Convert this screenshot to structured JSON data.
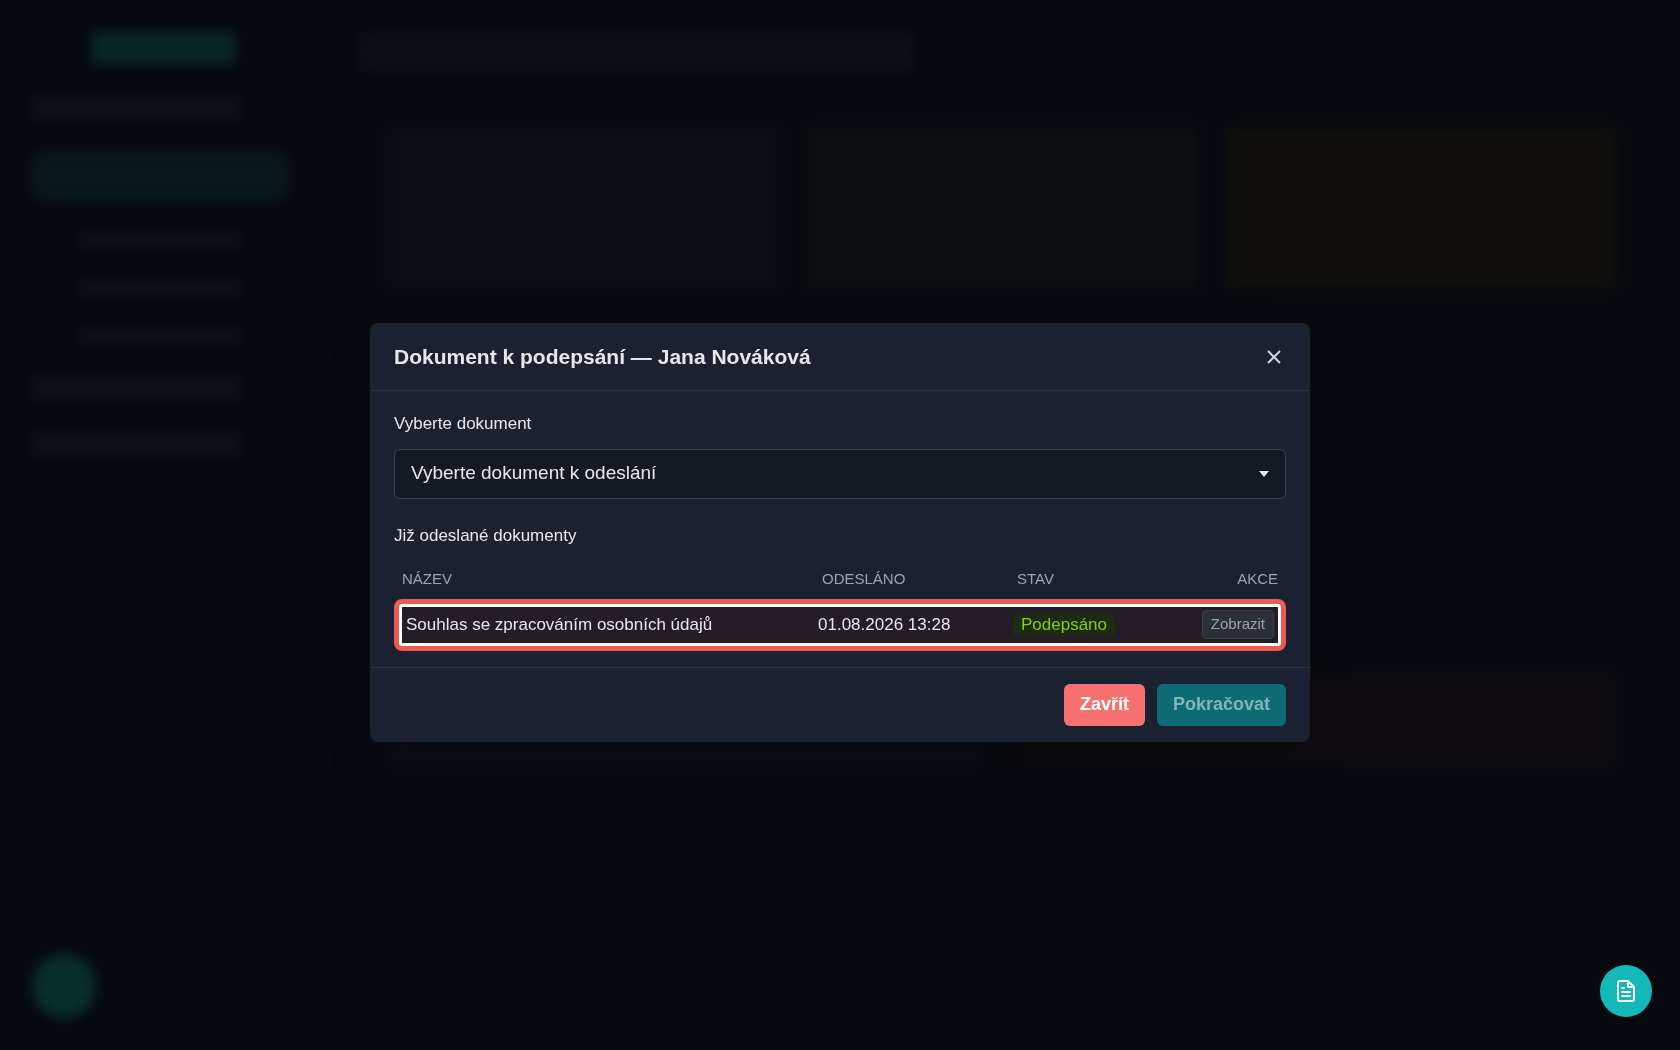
{
  "dialog": {
    "title": "Dokument k podepsání — Jana Nováková",
    "select_label": "Vyberte dokument",
    "select": {
      "placeholder": "Vyberte dokument k odeslání"
    },
    "sent_heading": "Již odeslané dokumenty",
    "table": {
      "columns": [
        "NÁZEV",
        "ODESLÁNO",
        "STAV",
        "AKCE"
      ],
      "rows": [
        {
          "name": "Souhlas se zpracováním osobních údajů",
          "sent": "01.08.2026 13:28",
          "status": "Podepsáno",
          "kind": "signed",
          "action": "Zobrazit",
          "highlighted": true
        }
      ]
    },
    "buttons": [
      {
        "label": "Zavřít",
        "kind": "danger"
      },
      {
        "label": "Pokračovat",
        "kind": "primary",
        "disabled": true
      }
    ]
  }
}
